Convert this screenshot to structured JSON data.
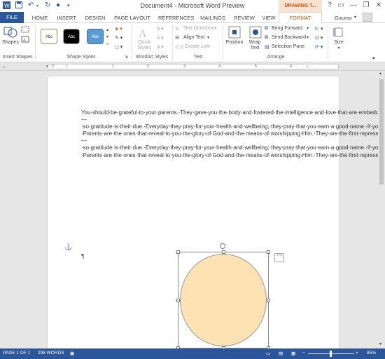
{
  "title_bar": {
    "document_title": "Document4 - Microsoft Word Preview",
    "contextual_tab_group": "DRAWING T...",
    "window_controls": [
      "?",
      "▭",
      "—",
      "❐",
      "✕"
    ]
  },
  "tabs": {
    "file": "FILE",
    "items": [
      "HOME",
      "INSERT",
      "DESIGN",
      "PAGE LAYOUT",
      "REFERENCES",
      "MAILINGS",
      "REVIEW",
      "VIEW"
    ],
    "active": "FORMAT",
    "user": "Gaurav"
  },
  "ribbon": {
    "insert_shapes": {
      "label": "Insert Shapes",
      "shapes_button": "Shapes"
    },
    "shape_styles": {
      "label": "Shape Styles",
      "style_samples": [
        "Abc",
        "Abc",
        "Abc"
      ]
    },
    "wordart_styles": {
      "label": "WordArt Styles",
      "quick_styles": "Quick Styles"
    },
    "text": {
      "label": "Text",
      "text_direction": "Text Direction",
      "align_text": "Align Text",
      "create_link": "Create Link"
    },
    "arrange": {
      "label": "Arrange",
      "position": "Position",
      "wrap_text": "Wrap Text",
      "bring_forward": "Bring Forward",
      "send_backward": "Send Backward",
      "selection_pane": "Selection Pane"
    },
    "size": {
      "label": "Size"
    }
  },
  "ruler": {
    "numbers": [
      "1",
      "2",
      "1",
      "2",
      "3",
      "4",
      "5",
      "6"
    ]
  },
  "document": {
    "body": "You·should·be·grateful·to·your·parents.·They·gave·you·the·body·and·fostered·the·intelligence·and·love·that·are·embedded·in·it·—·so·gratitude·is·their·due.·Everyday·they·pray·for·your·health·and·wellbeing;·they·pray·that·you·earn·a·good·name.·If·you·do·not·honour·them·who·are·your·living·Gods,·how·can·you·learn·to·honour·the·Almighty,·the·Creator·of·all?·Parents·are·the·ones·that·reveal·to·you·the·glory·of·God·and·the·means·of·worshipping·Him.·They·are·the·first·representatives·of·authority·a·child·meets,·the·authority·executed·through·love·and·care.·Learn·to·submit·yourselves·to·them·and·you·will·learn·how·to·submit·to·the·Lord.·You·must·conduct·and·behave·in·a·manner·that·your·parents·are·happy.·That·is·your·duty·and·it·is·only·when·you·fulfill·this·duty,·you·are·blessed·by·God.·You·should·be·grateful·to·your·parents.·They·gave·you·the·body·and·fostered·the·intelligence·and·love·that·are·embedded·in·it·—·so·gratitude·is·their·due.·Everyday·they·pray·for·your·health·and·wellbeing;·they·pray·that·you·earn·a·good·name.·If·you·do·not·honour·them·who·are·your·living·Gods,·how·can·you·learn·to·honour·the·Almighty,·the·Creator·of·all?·Parents·are·the·ones·that·reveal·to·you·the·glory·of·God·and·the·means·of·worshipping·Him.·They·are·the·first·representatives·of·authority·a·child·meets,·the·authority·executed·through·love·and·care.·Learn·to·submit·yourselves·to·them·and·you·will·learn·how·to·submit·to·the·Lord.·You·must·conduct·and·behave·in·a·manner·that·your·parents·are·happy.·That·is·your·duty·and·it·is·only·when·you·fulfill·this·duty,·you·are·blessed·by·God.¶",
    "empty_paragraph": "¶",
    "shape_fill": "#fde3b4"
  },
  "status_bar": {
    "page": "PAGE 1 OF 1",
    "words": "298 WORDS",
    "zoom": "85%",
    "zoom_level": 0.48
  }
}
